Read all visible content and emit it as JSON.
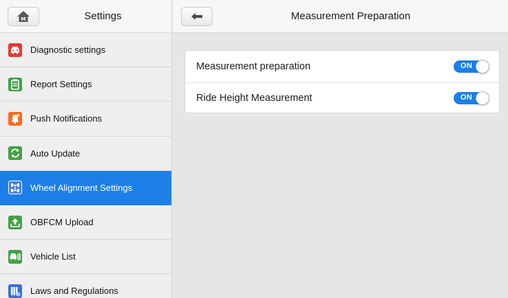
{
  "left": {
    "title": "Settings",
    "home_icon": "home-icon",
    "items": [
      {
        "label": "Diagnostic settings",
        "icon": "car-icon",
        "color": "#e53935",
        "active": false
      },
      {
        "label": "Report Settings",
        "icon": "clipboard-icon",
        "color": "#43a047",
        "active": false
      },
      {
        "label": "Push Notifications",
        "icon": "bell-icon",
        "color": "#fb6a1c",
        "active": false
      },
      {
        "label": "Auto Update",
        "icon": "refresh-icon",
        "color": "#43a047",
        "active": false
      },
      {
        "label": "Wheel Alignment Settings",
        "icon": "wheel-alignment-icon",
        "color": "#4a7fe0",
        "active": true
      },
      {
        "label": "OBFCM Upload",
        "icon": "upload-icon",
        "color": "#43a047",
        "active": false
      },
      {
        "label": "Vehicle List",
        "icon": "vehicle-list-icon",
        "color": "#43a047",
        "active": false
      },
      {
        "label": "Laws and Regulations",
        "icon": "books-icon",
        "color": "#3a6fd8",
        "active": false
      }
    ]
  },
  "right": {
    "title": "Measurement Preparation",
    "back_icon": "back-arrow-icon",
    "settings": [
      {
        "label": "Measurement preparation",
        "toggle": "ON",
        "on": true
      },
      {
        "label": "Ride Height Measurement",
        "toggle": "ON",
        "on": true
      }
    ]
  },
  "colors": {
    "accent": "#1c7fe8",
    "background": "#e6e6e6",
    "panel": "#efefef"
  }
}
